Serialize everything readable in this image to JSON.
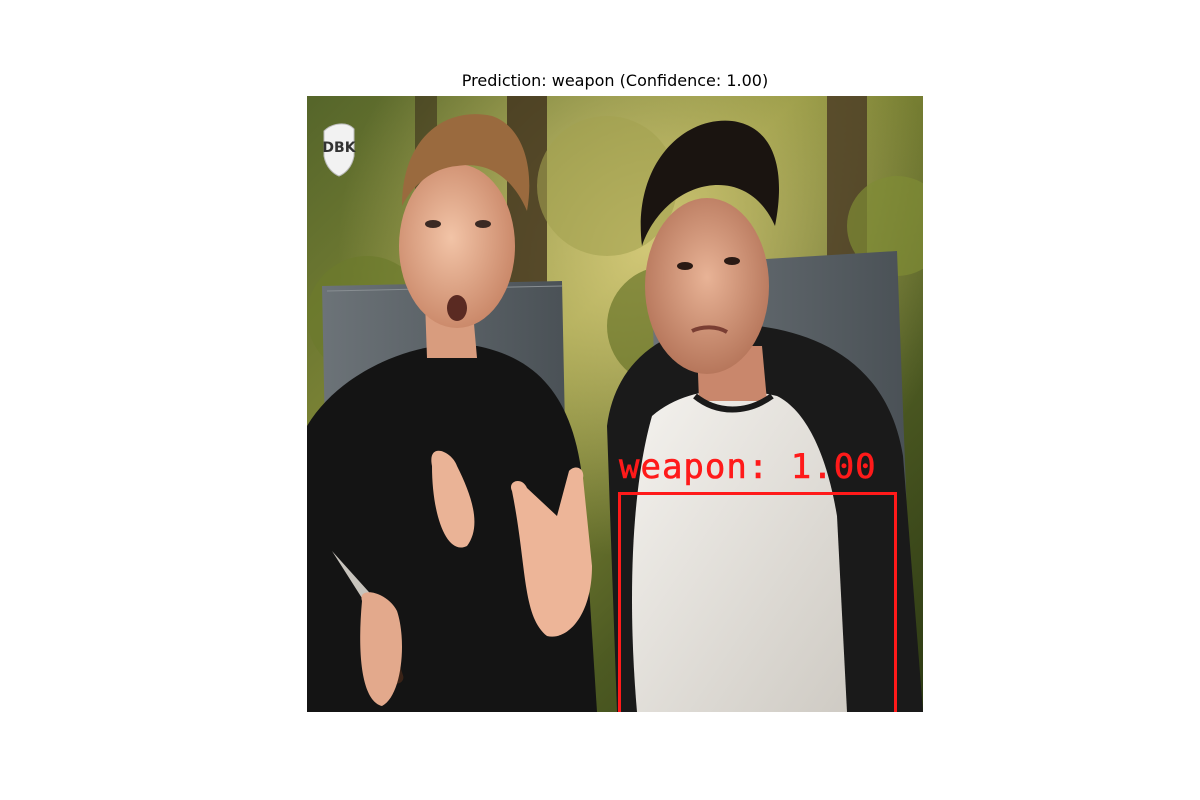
{
  "figure": {
    "title": "Prediction: weapon (Confidence: 1.00)"
  },
  "detection": {
    "label": "weapon: 1.00",
    "class": "weapon",
    "confidence": 1.0,
    "box_color": "#ff1a1a"
  },
  "watermark": {
    "text": "DBK"
  }
}
